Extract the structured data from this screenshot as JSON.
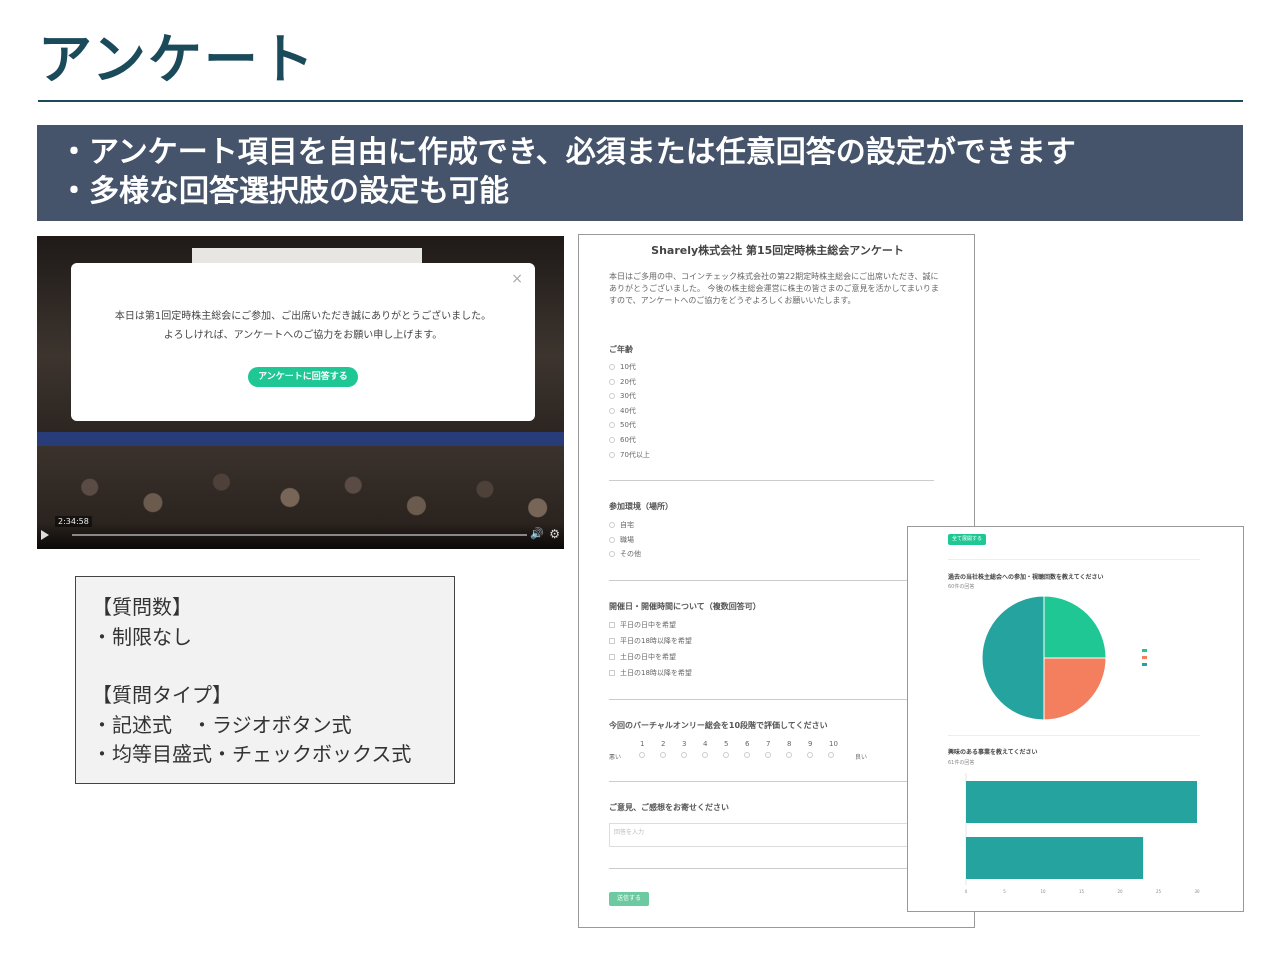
{
  "page": {
    "title": "アンケート",
    "bullets": [
      "・アンケート項目を自由に作成でき、必須または任意回答の設定ができます",
      "・多様な回答選択肢の設定も可能"
    ]
  },
  "video": {
    "modal_line1": "本日は第1回定時株主総会にご参加、ご出席いただき誠にありがとうございました。",
    "modal_line2": "よろしければ、アンケートへのご協力をお願い申し上げます。",
    "modal_button": "アンケートに回答する",
    "close": "×",
    "time": "2:34:58",
    "vol": "🔊",
    "gear": "⚙"
  },
  "spec": {
    "h1": "【質問数】",
    "l1": "・制限なし",
    "h2": "【質問タイプ】",
    "l2": "・記述式　・ラジオボタン式",
    "l3": "・均等目盛式・チェックボックス式"
  },
  "form": {
    "title": "Sharely株式会社 第15回定時株主総会アンケート",
    "intro": "本日はご多用の中、コインチェック株式会社の第22期定時株主総会にご出席いただき、誠にありがとうございました。 今後の株主総会運営に株主の皆さまのご意見を活かしてまいりますので、アンケートへのご協力をどうぞよろしくお願いいたします。",
    "q1": "ご年齢",
    "q1_options": [
      "10代",
      "20代",
      "30代",
      "40代",
      "50代",
      "60代",
      "70代以上"
    ],
    "q2": "参加環境（場所）",
    "q2_options": [
      "自宅",
      "職場",
      "その他"
    ],
    "q3": "開催日・開催時間について（複数回答可）",
    "q3_options": [
      "平日の日中を希望",
      "平日の18時以降を希望",
      "土日の日中を希望",
      "土日の18時以降を希望"
    ],
    "q4": "今回のバーチャルオンリー総会を10段階で評価してください",
    "q4_scale": [
      "1",
      "2",
      "3",
      "4",
      "5",
      "6",
      "7",
      "8",
      "9",
      "10"
    ],
    "q4_low": "悪い",
    "q4_high": "良い",
    "q5": "ご意見、ご感想をお寄せください",
    "q5_placeholder": "回答を入力",
    "submit": "送信する"
  },
  "results": {
    "button": "全て展開する",
    "pie_question": "過去の当社株主総会への参加・視聴回数を教えてください",
    "pie_count": "60件の回答",
    "bar_question": "興味のある事業を教えてください",
    "bar_count": "61件の回答"
  },
  "chart_data": [
    {
      "type": "pie",
      "title": "過去の当社株主総会への参加・視聴回数を教えてください",
      "values": [
        25,
        25,
        50
      ],
      "colors": [
        "#1fc794",
        "#f47f5f",
        "#25a39e"
      ]
    },
    {
      "type": "bar",
      "orientation": "horizontal",
      "title": "興味のある事業を教えてください",
      "values": [
        30,
        23
      ],
      "xlim": [
        0,
        30
      ],
      "ticks": [
        "0",
        "5",
        "10",
        "15",
        "20",
        "25",
        "30"
      ],
      "color": "#25a39e"
    }
  ]
}
